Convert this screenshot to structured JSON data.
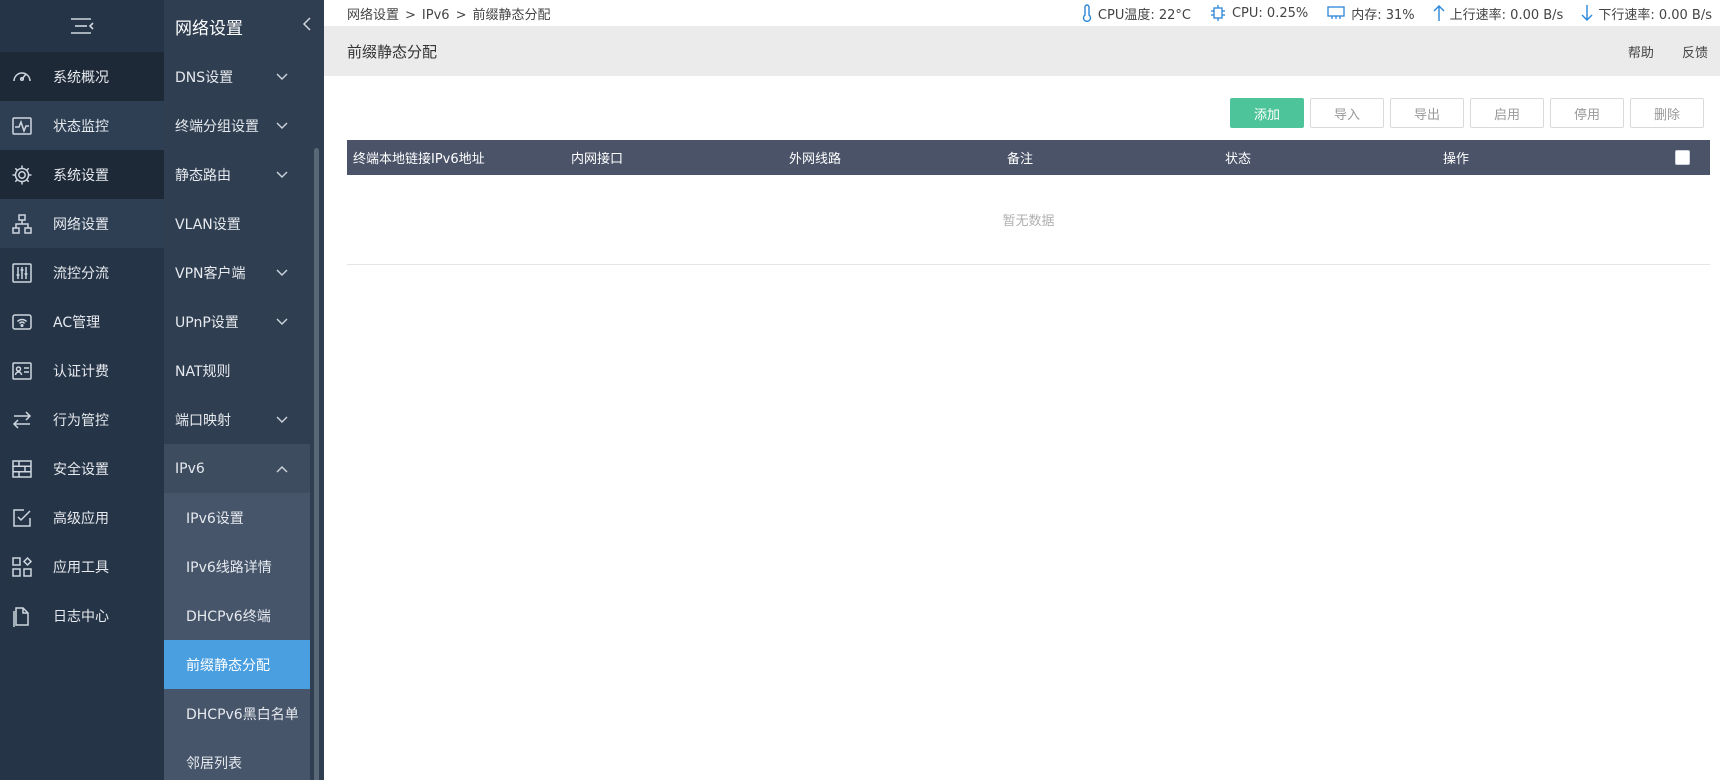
{
  "sidebar": {
    "items": [
      {
        "label": "系统概况",
        "icon": "dashboard-icon"
      },
      {
        "label": "状态监控",
        "icon": "monitor-icon"
      },
      {
        "label": "系统设置",
        "icon": "gear-icon"
      },
      {
        "label": "网络设置",
        "icon": "network-icon"
      },
      {
        "label": "流控分流",
        "icon": "sliders-icon"
      },
      {
        "label": "AC管理",
        "icon": "wifi-ap-icon"
      },
      {
        "label": "认证计费",
        "icon": "id-card-icon"
      },
      {
        "label": "行为管控",
        "icon": "swap-arrows-icon"
      },
      {
        "label": "安全设置",
        "icon": "firewall-icon"
      },
      {
        "label": "高级应用",
        "icon": "checklist-icon"
      },
      {
        "label": "应用工具",
        "icon": "apps-icon"
      },
      {
        "label": "日志中心",
        "icon": "document-icon"
      }
    ]
  },
  "subnav": {
    "title": "网络设置",
    "items": [
      {
        "label": "DNS设置"
      },
      {
        "label": "终端分组设置"
      },
      {
        "label": "静态路由"
      },
      {
        "label": "VLAN设置"
      },
      {
        "label": "VPN客户端"
      },
      {
        "label": "UPnP设置"
      },
      {
        "label": "NAT规则"
      },
      {
        "label": "端口映射"
      },
      {
        "label": "IPv6"
      }
    ],
    "sub_items": [
      {
        "label": "IPv6设置"
      },
      {
        "label": "IPv6线路详情"
      },
      {
        "label": "DHCPv6终端"
      },
      {
        "label": "前缀静态分配"
      },
      {
        "label": "DHCPv6黑白名单"
      },
      {
        "label": "邻居列表"
      }
    ]
  },
  "topbar": {
    "breadcrumb": [
      "网络设置",
      "IPv6",
      "前缀静态分配"
    ],
    "separator": ">",
    "cpu_temp": "CPU温度: 22°C",
    "cpu_usage": "CPU: 0.25%",
    "memory": "内存: 31%",
    "upload": "上行速率: 0.00 B/s",
    "download": "下行速率: 0.00 B/s"
  },
  "page": {
    "title": "前缀静态分配",
    "help": "帮助",
    "feedback": "反馈"
  },
  "toolbar": {
    "add": "添加",
    "import": "导入",
    "export": "导出",
    "enable": "启用",
    "disable": "停用",
    "delete": "删除"
  },
  "table": {
    "columns": [
      "终端本地链接IPv6地址",
      "内网接口",
      "外网线路",
      "备注",
      "状态",
      "操作"
    ],
    "empty_text": "暂无数据"
  },
  "colors": {
    "sidebar_bg": "#253447",
    "subnav_bg": "#2f3e50",
    "active_blue": "#4a9fe0",
    "add_green": "#4ec49a",
    "table_header": "#4a5368"
  }
}
